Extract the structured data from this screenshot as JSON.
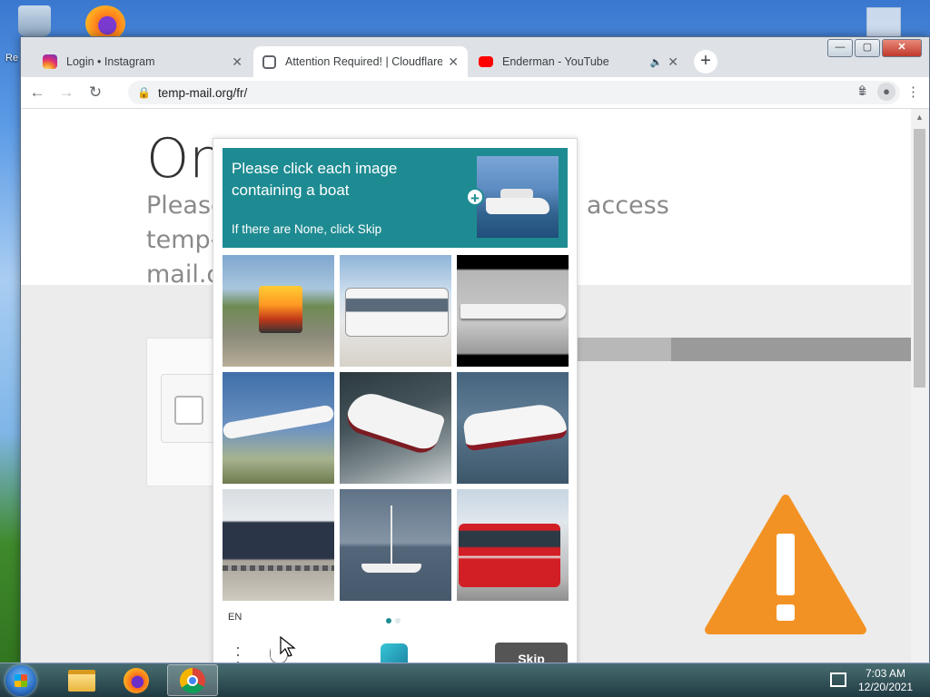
{
  "desktop": {
    "label_fragment": "Re"
  },
  "browser": {
    "tabs": [
      {
        "label": "Login • Instagram",
        "icon": "instagram-icon"
      },
      {
        "label": "Attention Required! | Cloudflare",
        "icon": "globe-icon",
        "active": true
      },
      {
        "label": "Enderman - YouTube",
        "icon": "youtube-icon",
        "audio": true
      }
    ],
    "new_tab": "+",
    "url": "temp-mail.org/fr/",
    "window_controls": {
      "minimize": "—",
      "maximize": "▢",
      "close": "✕"
    }
  },
  "page": {
    "title_fragment": "On",
    "subtitle_fragment_left": "Please",
    "subtitle_fragment_right": "access temp-",
    "subtitle_line2_fragment": "mail.c",
    "warning_color": "#f39224"
  },
  "captcha": {
    "prompt": "Please click each image containing a boat",
    "skip_hint": "If there are None, click Skip",
    "images": [
      {
        "subject": "train",
        "scene": "sc-train1"
      },
      {
        "subject": "bus",
        "scene": "sc-bus1"
      },
      {
        "subject": "airplane",
        "scene": "sc-plane1"
      },
      {
        "subject": "airplane",
        "scene": "sc-plane2"
      },
      {
        "subject": "boat",
        "scene": "sc-boat1"
      },
      {
        "subject": "boat",
        "scene": "sc-boat2"
      },
      {
        "subject": "train",
        "scene": "sc-train2"
      },
      {
        "subject": "boat",
        "scene": "sc-sail"
      },
      {
        "subject": "bus",
        "scene": "sc-bus2"
      }
    ],
    "language": "EN",
    "page_dots": 2,
    "active_dot": 0,
    "skip_label": "Skip",
    "accent_color": "#1e8b92"
  },
  "taskbar": {
    "time": "7:03 AM",
    "date": "12/20/2021",
    "pinned": [
      "folder-icon",
      "firefox-icon",
      "chrome-icon"
    ],
    "active": "chrome-icon"
  }
}
